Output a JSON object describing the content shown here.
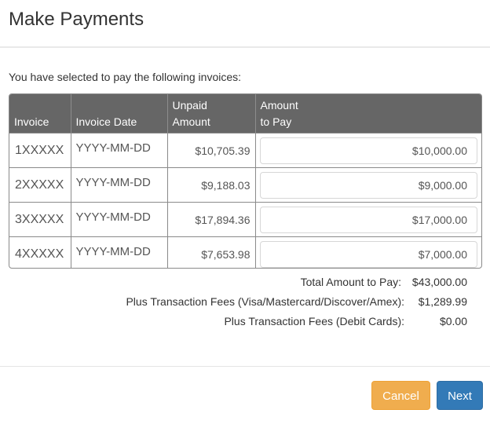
{
  "modal": {
    "title": "Make Payments",
    "intro": "You have selected to pay the following invoices:"
  },
  "table": {
    "headers": {
      "invoice": "Invoice",
      "invoice_date": "Invoice Date",
      "unpaid_line1": "Unpaid",
      "unpaid_line2": "Amount",
      "topay_line1": "Amount",
      "topay_line2": "to Pay"
    },
    "rows": [
      {
        "invoice": "1XXXXX",
        "date": "YYYY-MM-DD",
        "unpaid": "$10,705.39",
        "to_pay": "$10,000.00"
      },
      {
        "invoice": "2XXXXX",
        "date": "YYYY-MM-DD",
        "unpaid": "$9,188.03",
        "to_pay": "$9,000.00"
      },
      {
        "invoice": "3XXXXX",
        "date": "YYYY-MM-DD",
        "unpaid": "$17,894.36",
        "to_pay": "$17,000.00"
      },
      {
        "invoice": "4XXXXX",
        "date": "YYYY-MM-DD",
        "unpaid": "$7,653.98",
        "to_pay": "$7,000.00"
      }
    ]
  },
  "summary": [
    {
      "label": "Total Amount to Pay:",
      "value": "$43,000.00"
    },
    {
      "label": "Plus Transaction Fees (Visa/Mastercard/Discover/Amex):",
      "value": "$1,289.99"
    },
    {
      "label": "Plus Transaction Fees (Debit Cards):",
      "value": "$0.00"
    }
  ],
  "footer": {
    "cancel_label": "Cancel",
    "next_label": "Next"
  },
  "colors": {
    "header_bg": "#666666",
    "cancel": "#f0ad4e",
    "next": "#337ab7"
  }
}
